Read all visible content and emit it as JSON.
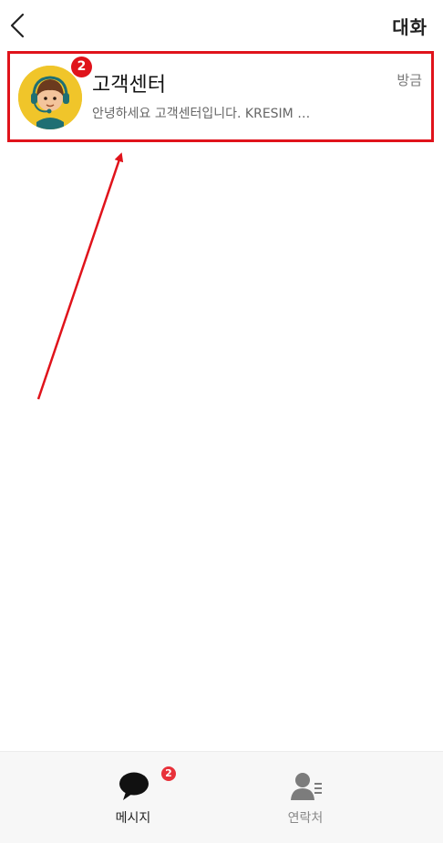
{
  "header": {
    "title": "대화",
    "back_icon": "chevron-left-icon"
  },
  "chats": [
    {
      "name": "고객센터",
      "time": "방금",
      "preview": "안녕하세요 고객센터입니다. KRESIM …",
      "unread": "2",
      "avatar_icon": "support-agent-avatar"
    }
  ],
  "nav": {
    "messages": {
      "label": "메시지",
      "badge": "2",
      "icon": "chat-bubble-icon",
      "active": true
    },
    "contacts": {
      "label": "연락처",
      "icon": "contact-person-icon",
      "active": false
    }
  },
  "colors": {
    "highlight": "#e0131b",
    "badge": "#e8313a",
    "avatar_bg": "#f0c52a"
  }
}
